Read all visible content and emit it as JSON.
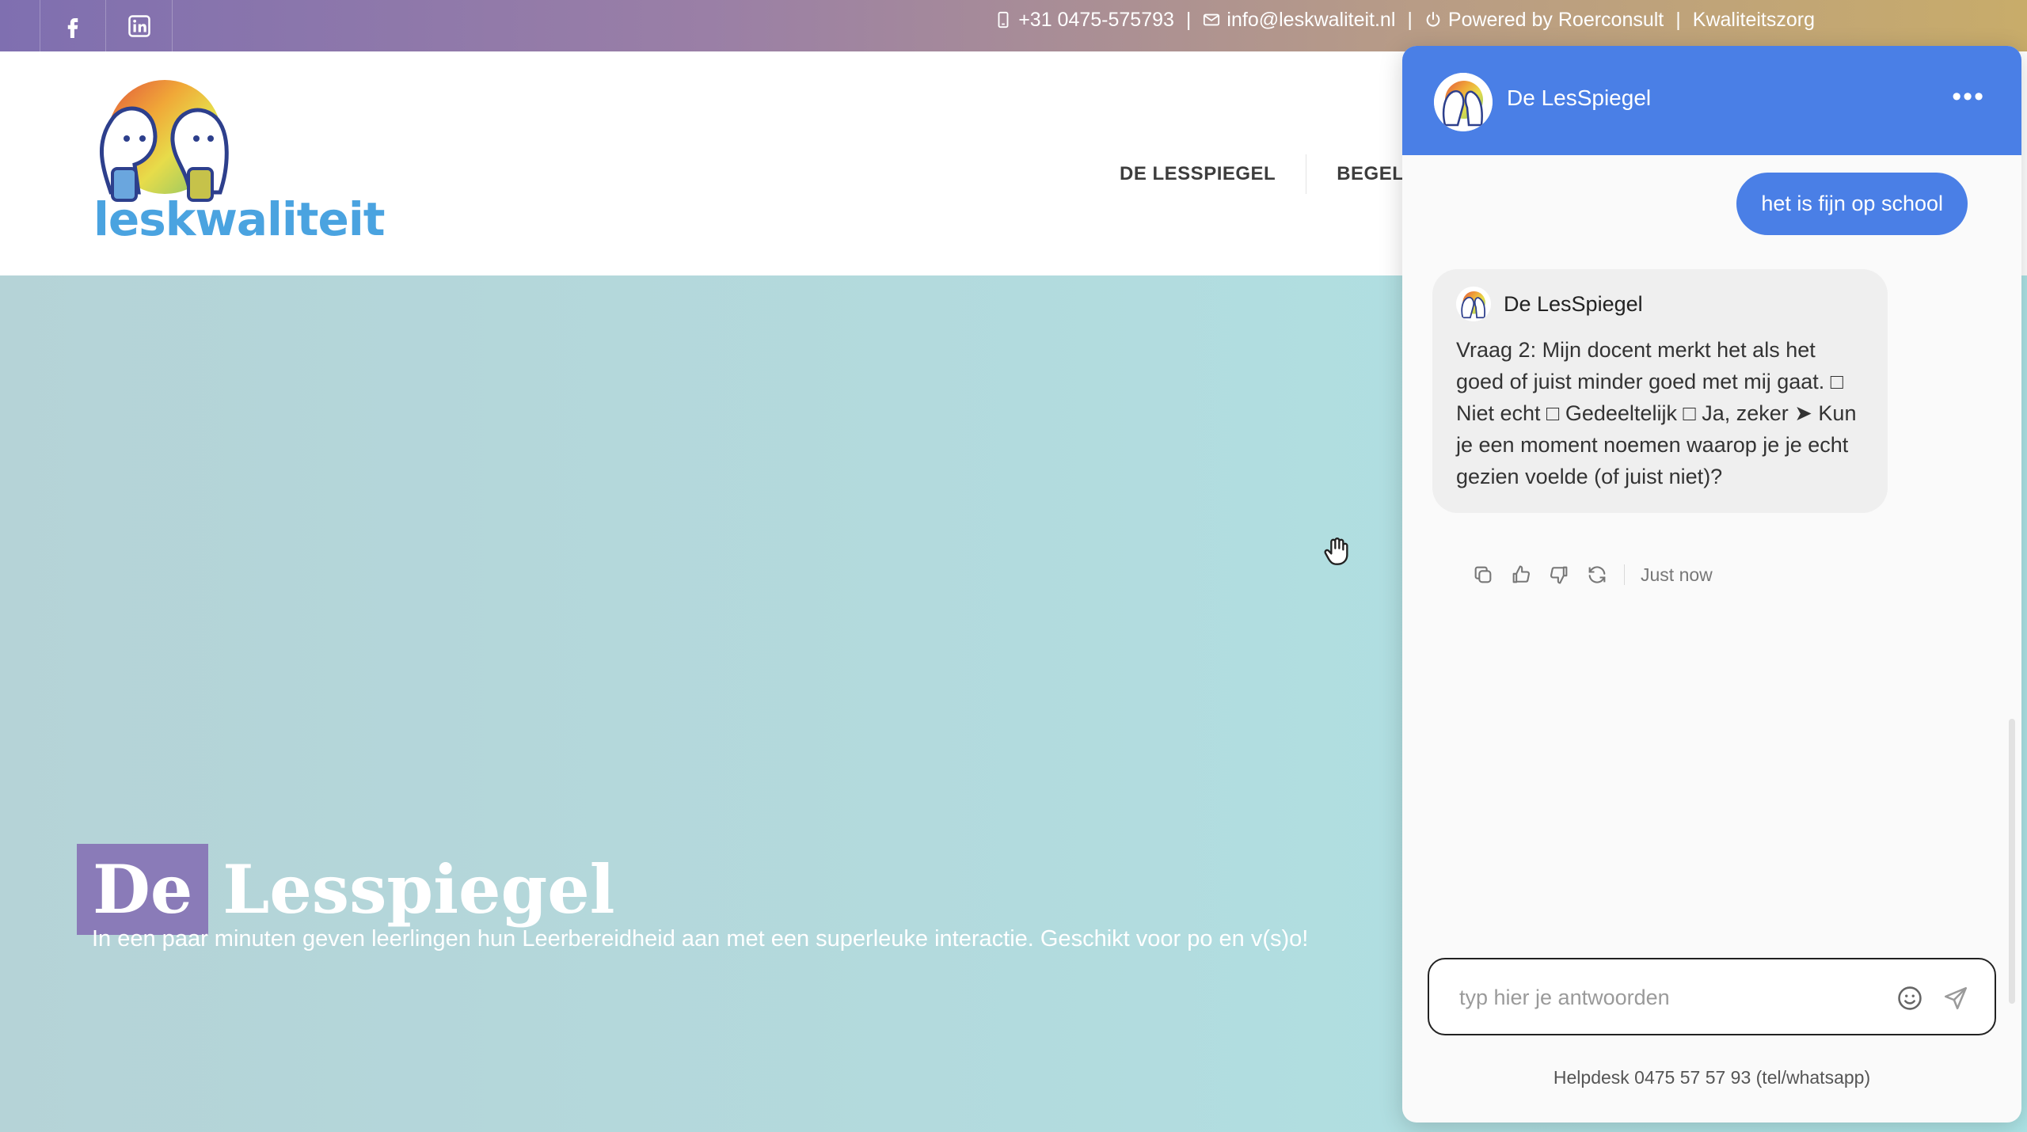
{
  "topbar": {
    "phone": "+31 0475-575793",
    "email": "info@leskwaliteit.nl",
    "powered": "Powered by Roerconsult",
    "quality": "Kwaliteitszorg",
    "separator": "|"
  },
  "logo": {
    "text": "leskwaliteit"
  },
  "nav": {
    "items": [
      "DE LESSPIEGEL",
      "BEGEL"
    ]
  },
  "hero": {
    "title_highlight": "De",
    "title_rest": "Lesspiegel",
    "subtitle": "In een paar minuten geven leerlingen hun Leerbereidheid aan met een superleuke interactie. Geschikt voor po en v(s)o!"
  },
  "chat": {
    "title": "De LesSpiegel",
    "menu": "•••",
    "user_message": "het is fijn op school",
    "bot_name": "De LesSpiegel",
    "bot_message": "Vraag 2: Mijn docent merkt het als het goed of juist minder goed met mij gaat. □ Niet echt □ Gedeeltelijk □ Ja, zeker ➤ Kun je een moment noemen waarop je je echt gezien voelde (of juist niet)?",
    "timestamp": "Just now",
    "input_placeholder": "typ hier je antwoorden",
    "input_value": "",
    "helpdesk": "Helpdesk 0475 57 57 93 (tel/whatsapp)"
  },
  "colors": {
    "chat_accent": "#4a7fe6",
    "hero_highlight": "#8a7bb8",
    "logo_blue": "#4aa3e0"
  }
}
